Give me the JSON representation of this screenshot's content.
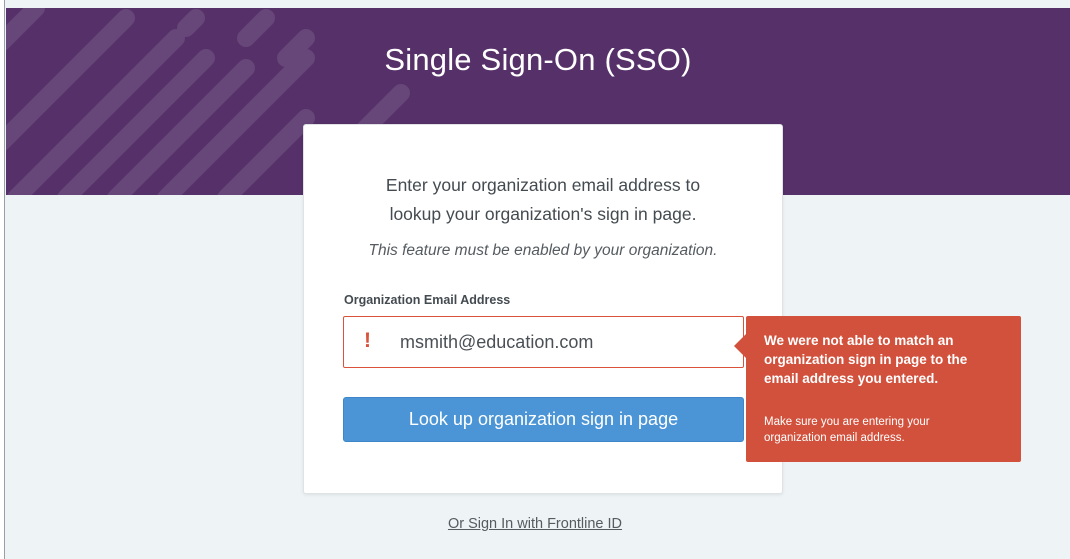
{
  "header": {
    "title": "Single Sign-On (SSO)",
    "background_color": "#563068"
  },
  "card": {
    "intro_line1": "Enter your organization email address to",
    "intro_line2": "lookup your organization's sign in page.",
    "note": "This feature must be enabled by your organization.",
    "email_label": "Organization Email Address",
    "email_value": "msmith@education.com",
    "error_mark": "!",
    "submit_label": "Look up organization sign in page"
  },
  "error_tooltip": {
    "message_line1": "We were not able to match an",
    "message_line2": "organization sign in page to the",
    "message_line3": "email address you entered.",
    "hint_line1": "Make sure you are entering your",
    "hint_line2": "organization email address.",
    "color": "#d2513c"
  },
  "alt_signin_link": "Or Sign In with Frontline ID",
  "colors": {
    "accent_button": "#4b95d6",
    "error": "#d9533c",
    "page_background": "#eef3f5"
  }
}
